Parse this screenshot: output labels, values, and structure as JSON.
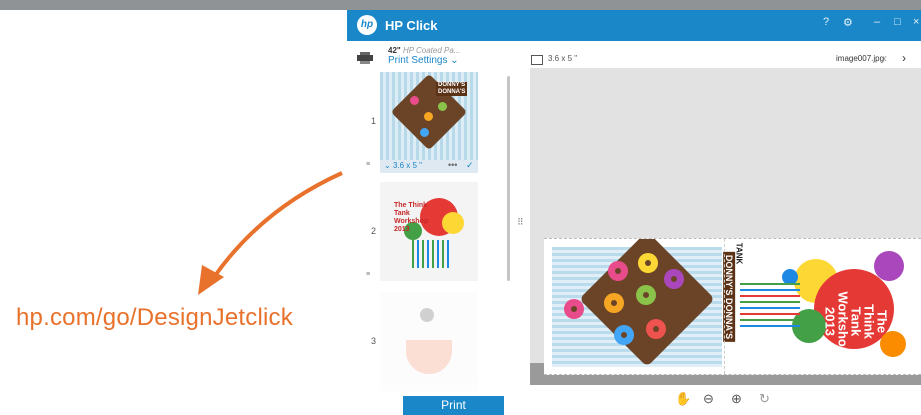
{
  "background": {
    "url_text": "hp.com/go/DesignJetclick",
    "accent": "#e8722c"
  },
  "app": {
    "title": "HP Click",
    "logo_text": "hp",
    "titlebar_buttons": [
      "?",
      "⚙",
      "–",
      "□",
      "×"
    ],
    "brand_color": "#1a87c9"
  },
  "sidebar": {
    "paper_size": "42\"",
    "paper_type": "HP Coated Pa...",
    "print_settings_label": "Print Settings",
    "pages": [
      {
        "number": "1"
      },
      {
        "number": "2"
      },
      {
        "number": "3"
      }
    ],
    "selected_size": "3.6 x 5 \"",
    "more_label": "•••",
    "check_label": "✓",
    "thumb1": {
      "title_line1": "DONNY'S",
      "title_line2": "DONNA'S"
    },
    "thumb2": {
      "title": "The Think Tank Workshop 2013"
    },
    "print_button_label": "Print"
  },
  "preview": {
    "dimensions": "3.6 x 5 \"",
    "filename": "image007.jpg",
    "prev_icon": "‹",
    "next_icon": "›",
    "donut_label": "DONNY'S DONNA'S",
    "tank_label": "TANK",
    "workshop_title": "The Think Tank Workshop 2013"
  },
  "toolbar": {
    "icons": [
      "hand-icon",
      "zoom-out-icon",
      "zoom-in-icon",
      "rotate-icon"
    ]
  }
}
